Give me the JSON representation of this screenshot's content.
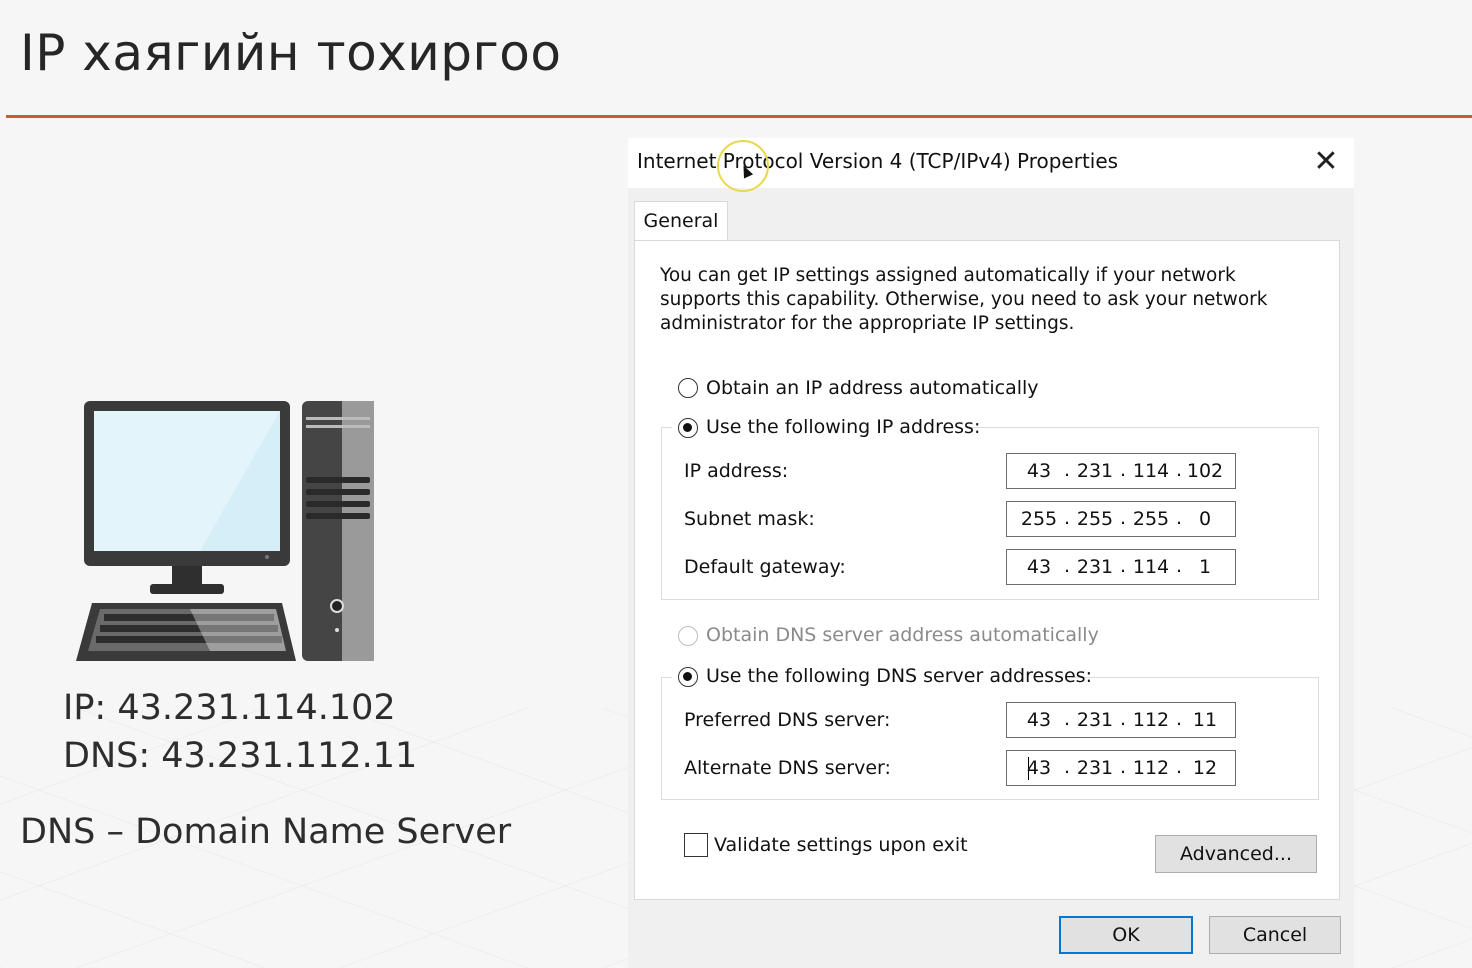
{
  "slide": {
    "title": "IP хаягийн тохиргоо",
    "ip_line": "IP: 43.231.114.102",
    "dns_line": "DNS: 43.231.112.11",
    "dns_meaning": "DNS – Domain Name Server",
    "accent_color": "#d2582f"
  },
  "dialog": {
    "title": "Internet Protocol Version 4 (TCP/IPv4) Properties",
    "close_icon": "close-icon",
    "tab": "General",
    "description": "You can get IP settings assigned automatically if your network supports this capability. Otherwise, you need to ask your network administrator for the appropriate IP settings.",
    "ip_section": {
      "auto_label": "Obtain an IP address automatically",
      "auto_checked": false,
      "manual_label": "Use the following IP address:",
      "manual_checked": true,
      "fields": [
        {
          "label": "IP address:",
          "octets": [
            "43",
            "231",
            "114",
            "102"
          ]
        },
        {
          "label": "Subnet mask:",
          "octets": [
            "255",
            "255",
            "255",
            "0"
          ]
        },
        {
          "label": "Default gateway:",
          "octets": [
            "43",
            "231",
            "114",
            "1"
          ]
        }
      ]
    },
    "dns_section": {
      "auto_label": "Obtain DNS server address automatically",
      "auto_checked": false,
      "auto_disabled": true,
      "manual_label": "Use the following DNS server addresses:",
      "manual_checked": true,
      "fields": [
        {
          "label": "Preferred DNS server:",
          "octets": [
            "43",
            "231",
            "112",
            "11"
          ]
        },
        {
          "label": "Alternate DNS server:",
          "octets": [
            "43",
            "231",
            "112",
            "12"
          ]
        }
      ]
    },
    "validate_label": "Validate settings upon exit",
    "validate_checked": false,
    "advanced_button": "Advanced...",
    "ok_button": "OK",
    "cancel_button": "Cancel"
  }
}
